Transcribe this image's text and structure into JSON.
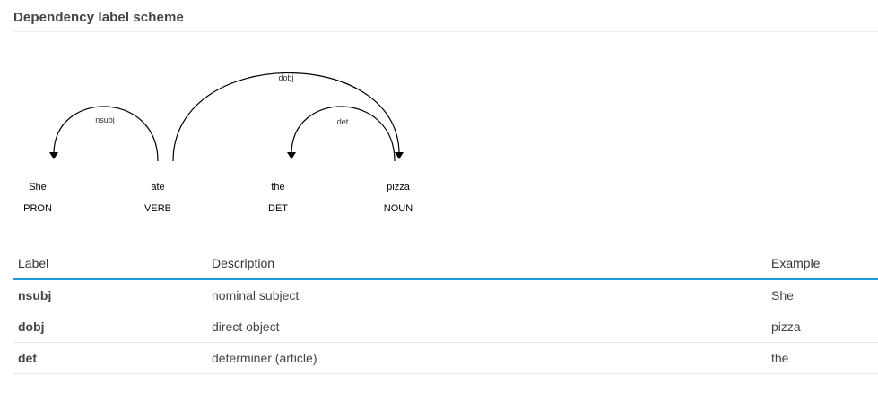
{
  "section": {
    "title": "Dependency label scheme"
  },
  "diagram": {
    "tokens": [
      {
        "word": "She",
        "tag": "PRON"
      },
      {
        "word": "ate",
        "tag": "VERB"
      },
      {
        "word": "the",
        "tag": "DET"
      },
      {
        "word": "pizza",
        "tag": "NOUN"
      }
    ],
    "arcs": [
      {
        "label": "nsubj",
        "head": "ate",
        "dependent": "She"
      },
      {
        "label": "dobj",
        "head": "ate",
        "dependent": "pizza"
      },
      {
        "label": "det",
        "head": "pizza",
        "dependent": "the"
      }
    ]
  },
  "table": {
    "headers": {
      "label": "Label",
      "description": "Description",
      "example": "Example"
    },
    "rows": [
      {
        "label": "nsubj",
        "description": "nominal subject",
        "example": "She"
      },
      {
        "label": "dobj",
        "description": "direct object",
        "example": "pizza"
      },
      {
        "label": "det",
        "description": "determiner (article)",
        "example": "the"
      }
    ]
  }
}
